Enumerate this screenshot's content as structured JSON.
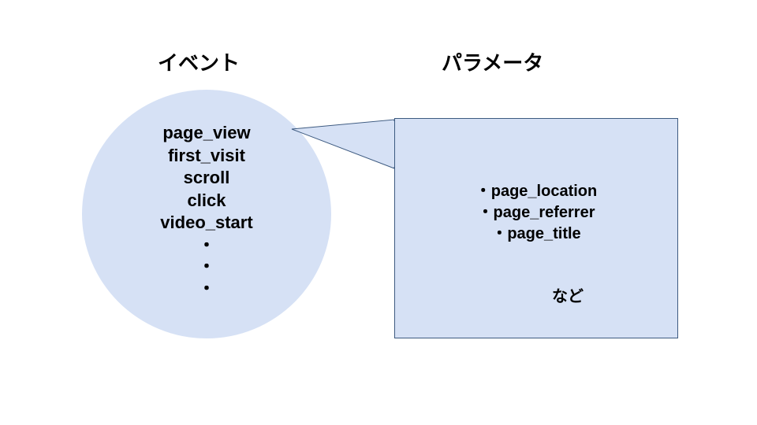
{
  "titles": {
    "events": "イベント",
    "params": "パラメータ"
  },
  "events": {
    "items": [
      "page_view",
      "first_visit",
      "scroll",
      "click",
      "video_start"
    ],
    "ellipsis": "・\n・\n・"
  },
  "parameters": {
    "items": [
      "page_location",
      "page_referrer",
      "page_title"
    ],
    "bullet": "・",
    "suffix": "など"
  },
  "colors": {
    "shape_fill": "#d6e1f5",
    "border": "#3d5a80"
  }
}
